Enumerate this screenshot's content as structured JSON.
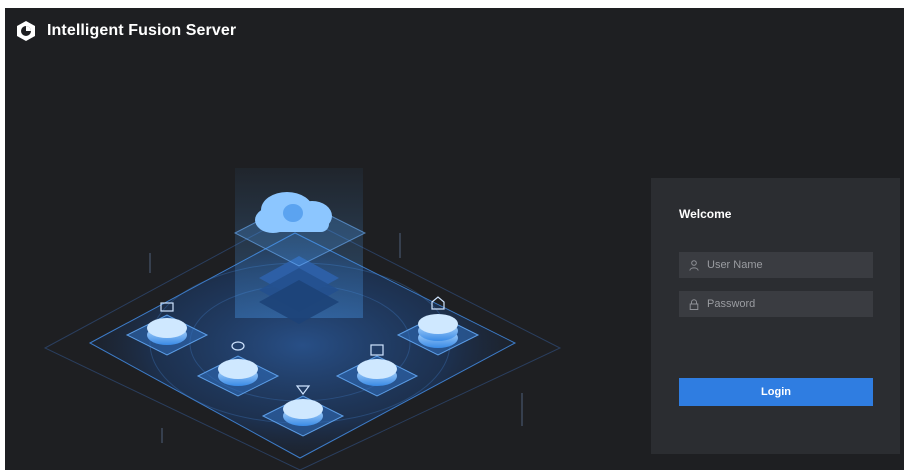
{
  "app": {
    "title": "Intelligent Fusion Server",
    "logo_icon": "app-logo-icon"
  },
  "login": {
    "welcome_text": "Welcome",
    "username": {
      "placeholder": "User Name",
      "value": "",
      "icon": "user-icon"
    },
    "password": {
      "placeholder": "Password",
      "value": "",
      "icon": "lock-icon"
    },
    "login_label": "Login"
  },
  "colors": {
    "background": "#1e1f22",
    "panel": "#2b2d31",
    "field": "#3a3c41",
    "accent": "#2f7de1",
    "illustration_blue": "#4a9cf0"
  }
}
